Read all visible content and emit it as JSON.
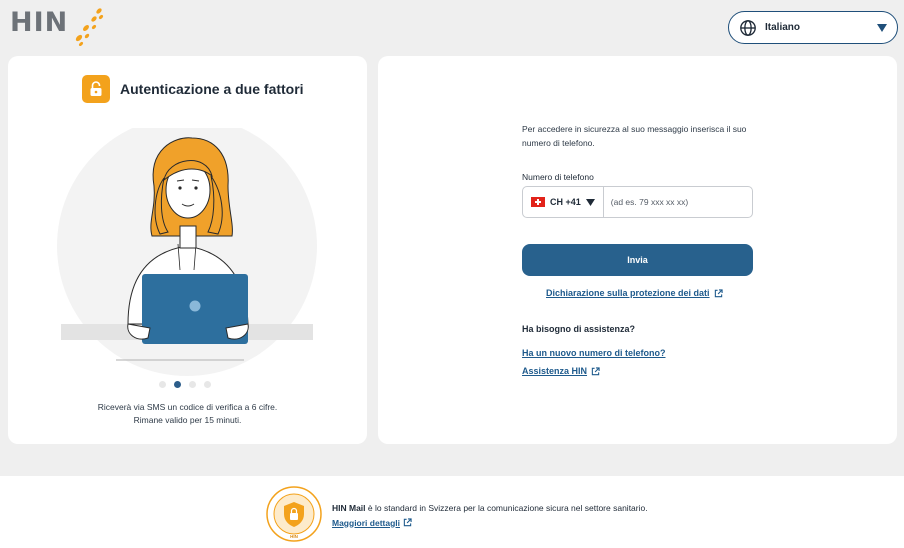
{
  "header": {
    "logo_text": "HIN",
    "language": {
      "selected": "Italiano",
      "icon": "globe-icon"
    }
  },
  "left_card": {
    "title": "Autenticazione a due fattori",
    "title_icon": "lock-icon",
    "carousel": {
      "count": 4,
      "active_index": 1
    },
    "caption_line1": "Riceverà via SMS un codice di verifica a 6 cifre.",
    "caption_line2": "Rimane valido per 15 minuti."
  },
  "right_card": {
    "intro": "Per accedere in sicurezza al suo messaggio inserisca il suo numero di telefono.",
    "phone_label": "Numero di telefono",
    "country_code": "CH  +41",
    "phone_placeholder": "(ad es. 79 xxx xx xx)",
    "phone_value": "",
    "submit_label": "Invia",
    "privacy_link": "Dichiarazione sulla protezione dei dati",
    "help_heading": "Ha bisogno di assistenza?",
    "new_number_link": "Ha un nuovo numero di telefono?",
    "support_link": "Assistenza HIN"
  },
  "footer": {
    "brand": "HIN Mail",
    "text": " è lo standard in Svizzera per la comunicazione sicura nel settore sanitario. ",
    "details_link": "Maggiori dettagli",
    "seal_text": "PROTEGGIAMO I VOSTRI DATI",
    "seal_brand": "HIN"
  },
  "colors": {
    "accent_orange": "#f3a21c",
    "primary_blue": "#28618d",
    "link_blue": "#1e5a8c",
    "background": "#efefef"
  }
}
